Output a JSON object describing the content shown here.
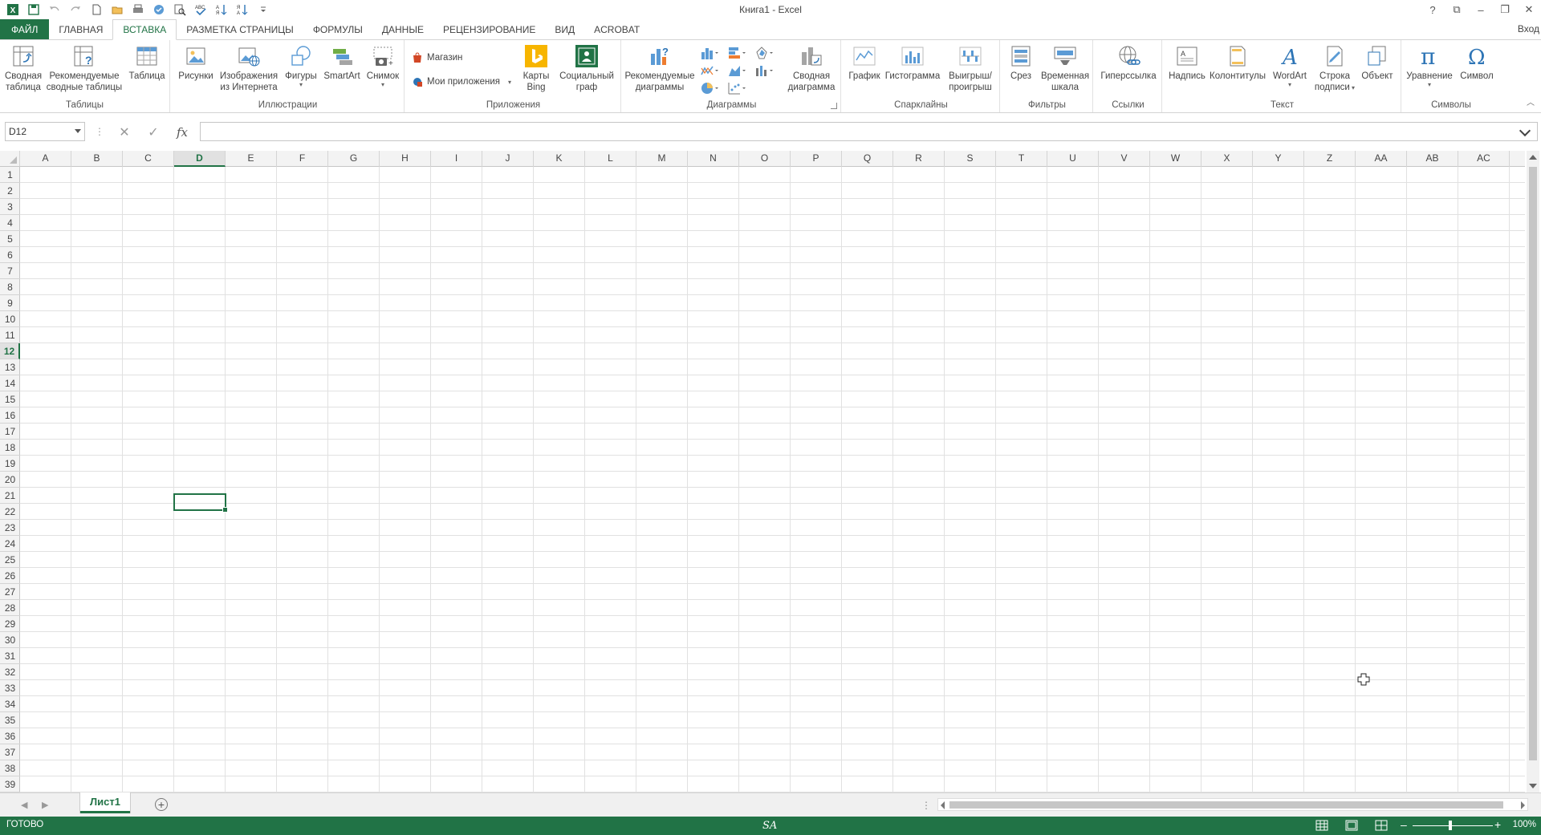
{
  "window": {
    "title": "Книга1 - Excel",
    "controls": {
      "help": "?",
      "restore_ribbon": "⧉",
      "minimize": "–",
      "maximize": "❐",
      "close": "✕"
    }
  },
  "tabs": {
    "file": "ФАЙЛ",
    "items": [
      "ГЛАВНАЯ",
      "ВСТАВКА",
      "РАЗМЕТКА СТРАНИЦЫ",
      "ФОРМУЛЫ",
      "ДАННЫЕ",
      "РЕЦЕНЗИРОВАНИЕ",
      "ВИД",
      "ACROBAT"
    ],
    "active_index": 1,
    "signin": "Вход"
  },
  "ribbon": {
    "groups": {
      "tables": "Таблицы",
      "illustrations": "Иллюстрации",
      "apps": "Приложения",
      "charts": "Диаграммы",
      "sparklines": "Спарклайны",
      "filters": "Фильтры",
      "links": "Ссылки",
      "text": "Текст",
      "symbols": "Символы"
    },
    "buttons": {
      "pivot_l1": "Сводная",
      "pivot_l2": "таблица",
      "recpivot_l1": "Рекомендуемые",
      "recpivot_l2": "сводные таблицы",
      "table": "Таблица",
      "pictures": "Рисунки",
      "online_l1": "Изображения",
      "online_l2": "из Интернета",
      "shapes": "Фигуры",
      "smartart": "SmartArt",
      "screenshot": "Снимок",
      "store": "Магазин",
      "myapps": "Мои приложения",
      "bing_l1": "Карты",
      "bing_l2": "Bing",
      "social_l1": "Социальный",
      "social_l2": "граф",
      "recchart_l1": "Рекомендуемые",
      "recchart_l2": "диаграммы",
      "pivotchart_l1": "Сводная",
      "pivotchart_l2": "диаграмма",
      "line": "График",
      "column": "Гистограмма",
      "winloss_l1": "Выигрыш/",
      "winloss_l2": "проигрыш",
      "slicer": "Срез",
      "timeline_l1": "Временная",
      "timeline_l2": "шкала",
      "hyperlink": "Гиперссылка",
      "textbox": "Надпись",
      "headerfooter": "Колонтитулы",
      "wordart": "WordArt",
      "sigline_l1": "Строка",
      "sigline_l2": "подписи",
      "object": "Объект",
      "equation": "Уравнение",
      "symbol": "Символ"
    }
  },
  "formula_bar": {
    "name_box": "D12",
    "fx": "fx",
    "value": ""
  },
  "grid": {
    "columns": [
      "A",
      "B",
      "C",
      "D",
      "E",
      "F",
      "G",
      "H",
      "I",
      "J",
      "K",
      "L",
      "M",
      "N",
      "O",
      "P",
      "Q",
      "R",
      "S",
      "T",
      "U",
      "V",
      "W",
      "X",
      "Y",
      "Z",
      "AA",
      "AB",
      "AC"
    ],
    "rows": [
      "1",
      "2",
      "3",
      "4",
      "5",
      "6",
      "7",
      "8",
      "9",
      "10",
      "11",
      "12",
      "13",
      "14",
      "15",
      "16",
      "17",
      "18",
      "19",
      "20",
      "21",
      "22",
      "23",
      "24",
      "25",
      "26",
      "27",
      "28",
      "29",
      "30",
      "31",
      "32",
      "33",
      "34",
      "35",
      "36",
      "37",
      "38",
      "39"
    ],
    "selected_column": "D",
    "selected_row": "12"
  },
  "sheets": {
    "tabs": [
      "Лист1"
    ],
    "add": "+"
  },
  "status": {
    "ready": "ГОТОВО",
    "center": "SA",
    "zoom": "100%",
    "zoom_minus": "–",
    "zoom_plus": "+"
  },
  "colors": {
    "accent": "#217346",
    "ribbon_bg": "#ffffff",
    "header_bg": "#f3f3f3"
  }
}
